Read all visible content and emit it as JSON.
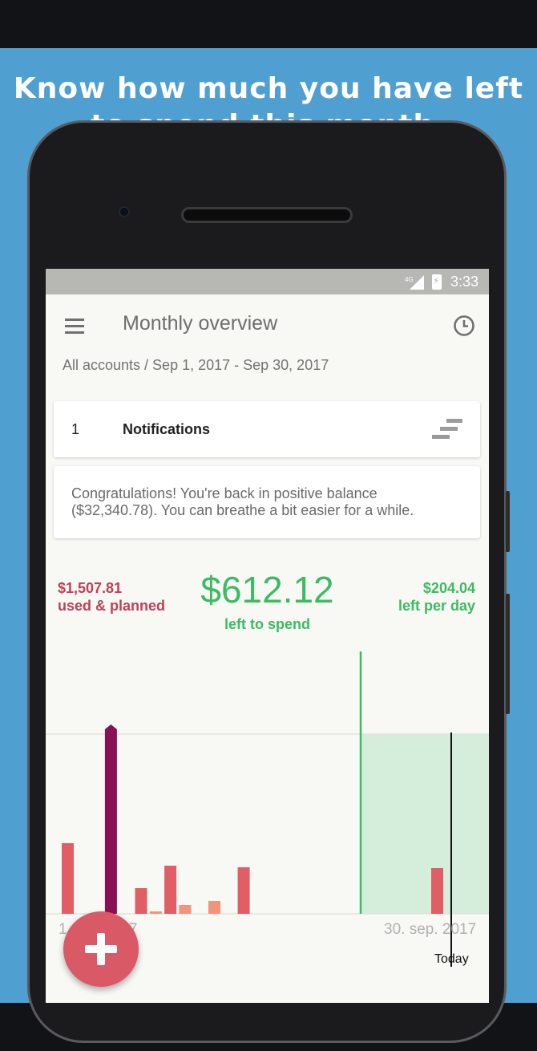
{
  "promo": {
    "line1": "Know how much you have left",
    "line2": "to spend this month."
  },
  "statusbar": {
    "network": "4G",
    "time": "3:33"
  },
  "appbar": {
    "menu_icon": "menu-icon",
    "title": "Monthly overview",
    "history_icon": "history-icon"
  },
  "subtitle": "All accounts / Sep 1, 2017 - Sep 30, 2017",
  "notifications": {
    "count": "1",
    "label": "Notifications",
    "icon": "stairs-icon"
  },
  "message": "Congratulations! You're back in positive balance ($32,340.78). You can breathe a bit easier for a while.",
  "summary": {
    "amount": "$612.12",
    "label": "left to spend",
    "color": "#3dbb63"
  },
  "chart_data": {
    "type": "bar",
    "title": "",
    "used": {
      "value": "$1,507.81",
      "label": "used & planned",
      "color": "#c0405a"
    },
    "per_day": {
      "value": "$204.04",
      "label": "left per day",
      "color": "#3dbb63"
    },
    "x_tick_left": "1.",
    "x_tick_left_suffix": "7",
    "x_tick_right": "30. sep. 2017",
    "today_label": "Today",
    "grid": true,
    "series": [
      {
        "values": [
          {
            "day": 1,
            "value": 88
          },
          {
            "day": 6,
            "value": 32
          },
          {
            "day": 8,
            "value": 60
          },
          {
            "day": 13,
            "value": 58
          }
        ],
        "color": "#e15e64"
      },
      {
        "values": [
          {
            "day": 7,
            "value": 3
          },
          {
            "day": 9,
            "value": 11
          },
          {
            "day": 11,
            "value": 16
          }
        ],
        "color": "#f4937c"
      }
    ],
    "cumulative_marker": {
      "day": 4,
      "value": 230,
      "color": "#8b0f55"
    },
    "today_day": 26
  },
  "fab": {
    "icon": "plus-icon",
    "color": "#d95a66"
  }
}
